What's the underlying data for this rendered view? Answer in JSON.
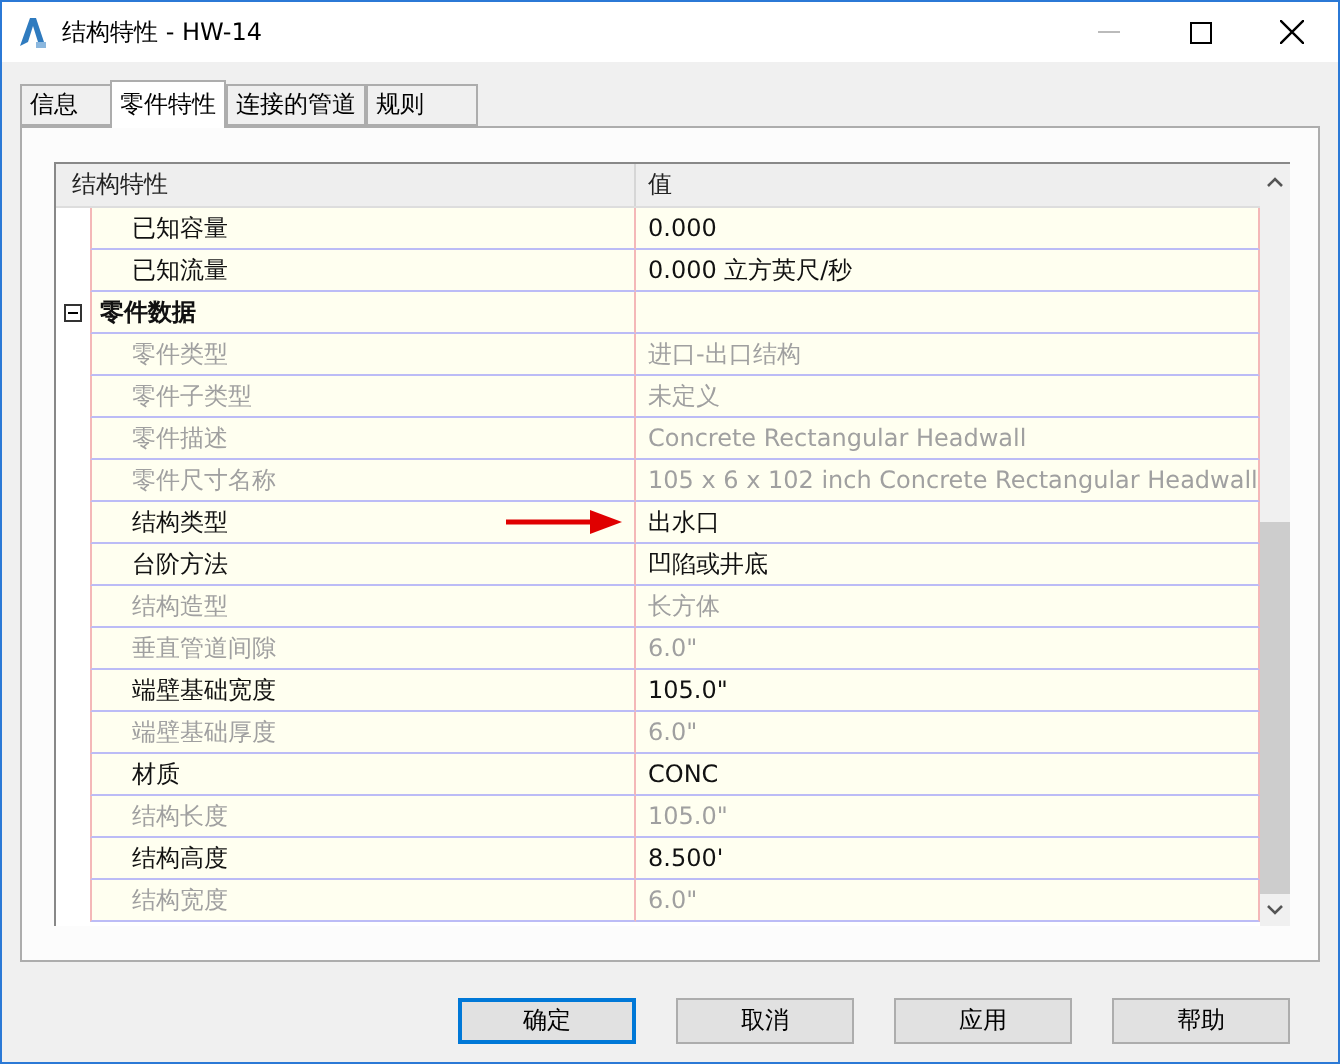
{
  "window": {
    "title": "结构特性 - HW-14"
  },
  "tabs": [
    {
      "label": "信息",
      "selected": false
    },
    {
      "label": "零件特性",
      "selected": true
    },
    {
      "label": "连接的管道",
      "selected": false
    },
    {
      "label": "规则",
      "selected": false
    }
  ],
  "grid": {
    "columns": [
      "结构特性",
      "值"
    ],
    "rows": [
      {
        "kind": "property",
        "name": "已知容量",
        "value": "0.000",
        "disabled": false
      },
      {
        "kind": "property",
        "name": "已知流量",
        "value": "0.000 立方英尺/秒",
        "disabled": false
      },
      {
        "kind": "category",
        "name": "零件数据",
        "expanded": true
      },
      {
        "kind": "property",
        "name": "零件类型",
        "value": "进口-出口结构",
        "disabled": true
      },
      {
        "kind": "property",
        "name": "零件子类型",
        "value": "未定义",
        "disabled": true
      },
      {
        "kind": "property",
        "name": "零件描述",
        "value": "Concrete Rectangular Headwall",
        "disabled": true
      },
      {
        "kind": "property",
        "name": "零件尺寸名称",
        "value": "105 x 6 x 102 inch Concrete Rectangular Headwall",
        "disabled": true
      },
      {
        "kind": "property",
        "name": "结构类型",
        "value": "出水口",
        "disabled": false,
        "annotated": true
      },
      {
        "kind": "property",
        "name": "台阶方法",
        "value": "凹陷或井底",
        "disabled": false
      },
      {
        "kind": "property",
        "name": "结构造型",
        "value": "长方体",
        "disabled": true
      },
      {
        "kind": "property",
        "name": "垂直管道间隙",
        "value": "6.0\"",
        "disabled": true
      },
      {
        "kind": "property",
        "name": "端壁基础宽度",
        "value": "105.0\"",
        "disabled": false
      },
      {
        "kind": "property",
        "name": "端壁基础厚度",
        "value": "6.0\"",
        "disabled": true
      },
      {
        "kind": "property",
        "name": "材质",
        "value": "CONC",
        "disabled": false
      },
      {
        "kind": "property",
        "name": "结构长度",
        "value": "105.0\"",
        "disabled": true
      },
      {
        "kind": "property",
        "name": "结构高度",
        "value": "8.500'",
        "disabled": false
      },
      {
        "kind": "property",
        "name": "结构宽度",
        "value": "6.0\"",
        "disabled": true
      }
    ]
  },
  "buttons": [
    {
      "label": "确定",
      "default": true
    },
    {
      "label": "取消",
      "default": false
    },
    {
      "label": "应用",
      "default": false
    },
    {
      "label": "帮助",
      "default": false
    }
  ]
}
